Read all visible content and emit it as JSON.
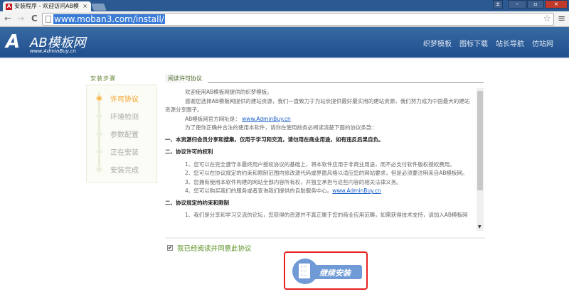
{
  "browser": {
    "tab_title": "安装程序 - 欢迎访问AB模",
    "favicon": "A",
    "tab_close": "×",
    "url": "www.moban3.com/install/",
    "back": "←",
    "forward": "→",
    "reload": "C",
    "star": "☆",
    "menu": "≡",
    "win_user": "±",
    "win_min": "–",
    "win_max": "▫",
    "win_close": "×"
  },
  "header": {
    "logo_mark": "A",
    "logo_name": "AB模板网",
    "logo_sub": "www.AdminBuy.cn",
    "nav": [
      "织梦模板",
      "图标下载",
      "站长导航",
      "仿站网"
    ]
  },
  "steps": {
    "title": "安装步骤",
    "items": [
      {
        "label": "许可协议",
        "active": true
      },
      {
        "label": "环境检测"
      },
      {
        "label": "参数配置"
      },
      {
        "label": "正在安装"
      },
      {
        "label": "安装完成"
      }
    ]
  },
  "agreement": {
    "title": "阅读许可协议",
    "p1": "欢迎使用AB模板网提供的织梦模板。",
    "p2": "感谢您选择AB模板网提供的建站资源，我们一直致力于为站长提供最好最实用的建站资源，我们努力成为中国最大的建站",
    "p2b": "资源分享圈子。",
    "p3": "AB模板网官方网址是：",
    "p3_link": "www.AdminBuy.cn",
    "p4": "为了使你正确并合法的使用本软件，请你在使用前务必阅读清楚下面的协议条款：",
    "h1": "一、本资源归会员分享和搜集，仅用于学习和交流，请勿用在商业用途，如有违反后果自负。",
    "h2": "二、协议许可的权利",
    "l1": "1、您可以在完全遵守本最终用户授权协议的基础上，将本软件应用于非商业用途，而不必支付软件版权授权费用。",
    "l2": "2、您可以在协议规定的约束和限制范围内修改源代码或界面风格以适应您的网站要求，但是必须要注明来自AB模板网。",
    "l3": "3、您拥有使用本软件构建的网站全部内容所有权，并独立承担与这些内容的相关法律义务。",
    "l4": "4、您可以购买我们的服务或者查询我们提供的自助服务中心。",
    "l4_link": "www.AdminBuy.cn",
    "h3": "二、协议规定的约束和限制",
    "m1": "1、我们是分享和学习交流的论坛，您获得的资源并不真正属于您的商业应用范畴，如需获得技术支持，请加入AB模板网"
  },
  "agree_checkbox": {
    "label": "我已经阅读并同意此协议",
    "checked": true,
    "mark": "✔"
  },
  "continue_button": {
    "label": "继续安装",
    "doc_icon": "✓—"
  }
}
